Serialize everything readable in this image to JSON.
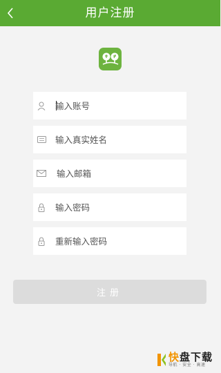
{
  "header": {
    "title": "用户注册",
    "back_icon": "chevron-left-icon",
    "background": "#5aaa33"
  },
  "logo": {
    "icon": "app-logo-icon",
    "color": "#6db33f"
  },
  "form": {
    "account": {
      "placeholder": "输入账号",
      "icon": "user-icon"
    },
    "real_name": {
      "placeholder": "输入真实姓名",
      "icon": "id-card-icon"
    },
    "email": {
      "placeholder": "输入邮箱",
      "icon": "mail-icon"
    },
    "password": {
      "placeholder": "输入密码",
      "icon": "lock-icon"
    },
    "password_confirm": {
      "placeholder": "重新输入密码",
      "icon": "lock-icon"
    }
  },
  "register_button": {
    "label": "注册",
    "color": "#dcdcdc"
  },
  "watermark": {
    "main_accent": "快",
    "main_rest": "盘下载",
    "sub": "导航 · 安全 · 高速"
  }
}
